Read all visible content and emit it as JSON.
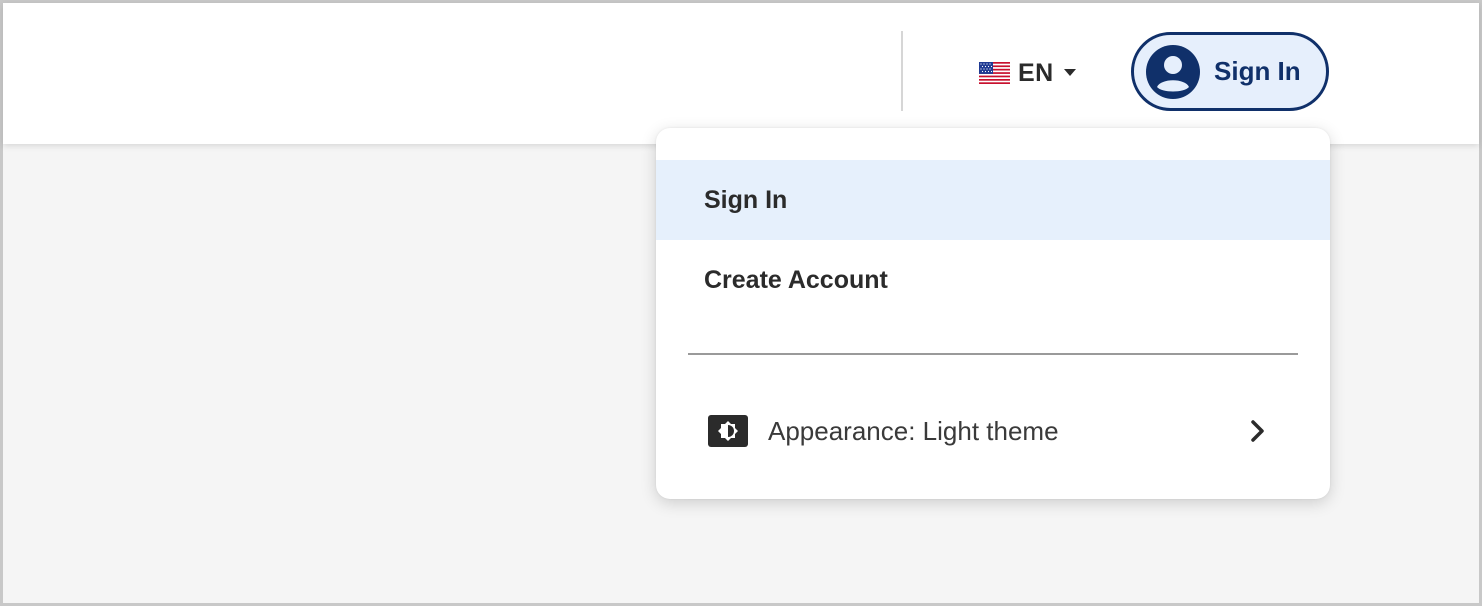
{
  "header": {
    "language": {
      "code": "EN",
      "flag_icon": "us-flag-icon",
      "dropdown_icon": "caret-down-icon"
    },
    "sign_in_button": {
      "label": "Sign In",
      "icon": "user-circle-icon"
    }
  },
  "account_menu": {
    "items": [
      {
        "label": "Sign In",
        "active": true
      },
      {
        "label": "Create Account",
        "active": false
      }
    ],
    "appearance": {
      "label": "Appearance: Light theme",
      "icon": "brightness-icon",
      "chevron_icon": "chevron-right-icon"
    }
  },
  "colors": {
    "brand_navy": "#10306a",
    "active_item_bg": "#e6f0fc",
    "page_bg": "#f5f5f5"
  }
}
